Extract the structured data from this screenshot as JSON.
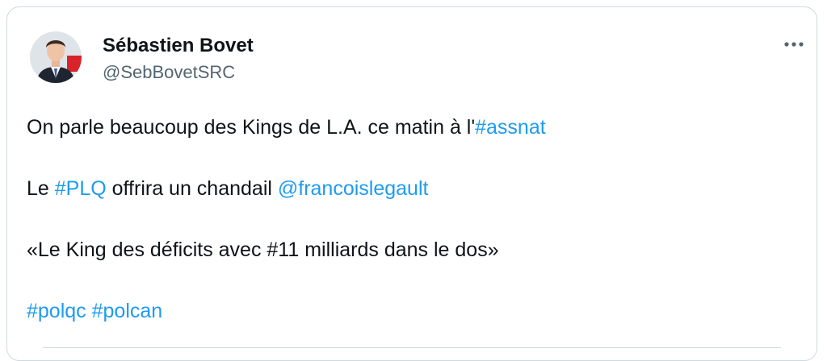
{
  "author": {
    "name": "Sébastien Bovet",
    "handle": "@SebBovetSRC"
  },
  "post": {
    "line1": {
      "text": "On parle beaucoup des Kings de L.A. ce matin à l'",
      "hashtag": "#assnat"
    },
    "line2": {
      "prefix": "Le ",
      "hashtag": "#PLQ",
      "middle": " offrira un chandail ",
      "mention": "@francoislegault"
    },
    "line3": {
      "text": "«Le King des déficits avec #11 milliards dans le dos»"
    },
    "line4": {
      "hashtag1": "#polqc",
      "separator": " ",
      "hashtag2": "#polcan"
    }
  },
  "icons": {
    "more": "more-horizontal-icon",
    "avatar": "profile-photo"
  },
  "colors": {
    "link": "#1d9bf0",
    "text": "#0f1419",
    "secondary": "#536471",
    "border": "#cfd9de"
  }
}
